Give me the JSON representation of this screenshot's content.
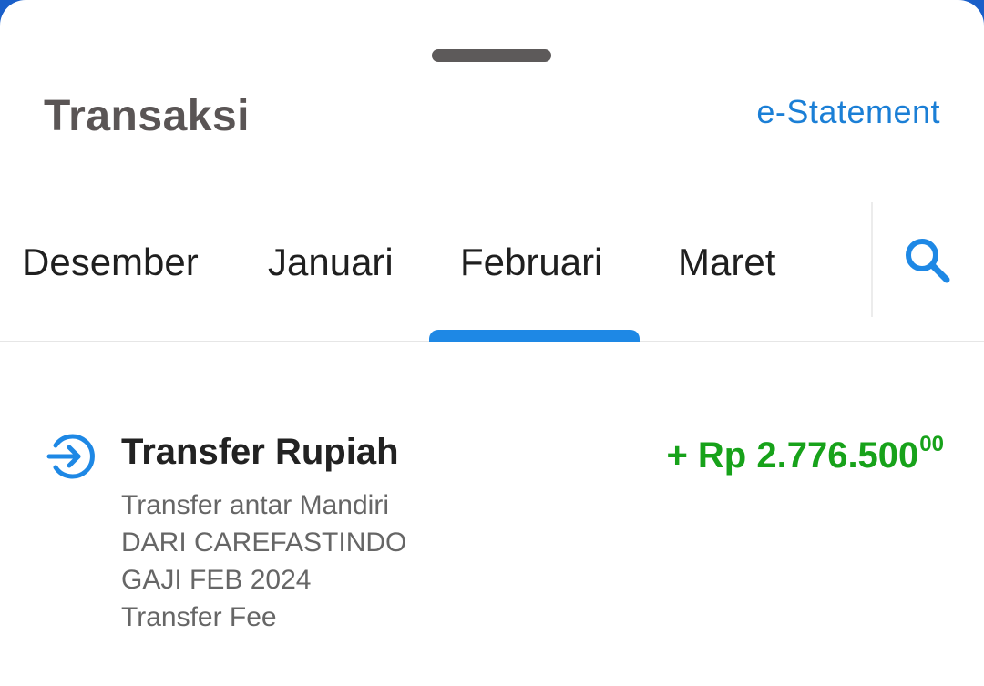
{
  "header": {
    "title": "Transaksi",
    "estatement_label": "e-Statement"
  },
  "tabs": [
    {
      "label": "Desember",
      "selected": false
    },
    {
      "label": "Januari",
      "selected": false
    },
    {
      "label": "Februari",
      "selected": true
    },
    {
      "label": "Maret",
      "selected": false
    }
  ],
  "search": {
    "icon": "search-icon"
  },
  "transactions": [
    {
      "icon": "transfer-in-icon",
      "title": "Transfer Rupiah",
      "amount_main": "+ Rp 2.776.500",
      "amount_decimal": "00",
      "description_lines": [
        "Transfer antar Mandiri",
        "DARI CAREFASTINDO",
        "GAJI FEB 2024",
        "Transfer Fee"
      ]
    }
  ],
  "colors": {
    "accent": "#1e88e5",
    "link": "#1b7fd6",
    "positive_amount": "#17a21a",
    "title_text": "#5a5555"
  }
}
